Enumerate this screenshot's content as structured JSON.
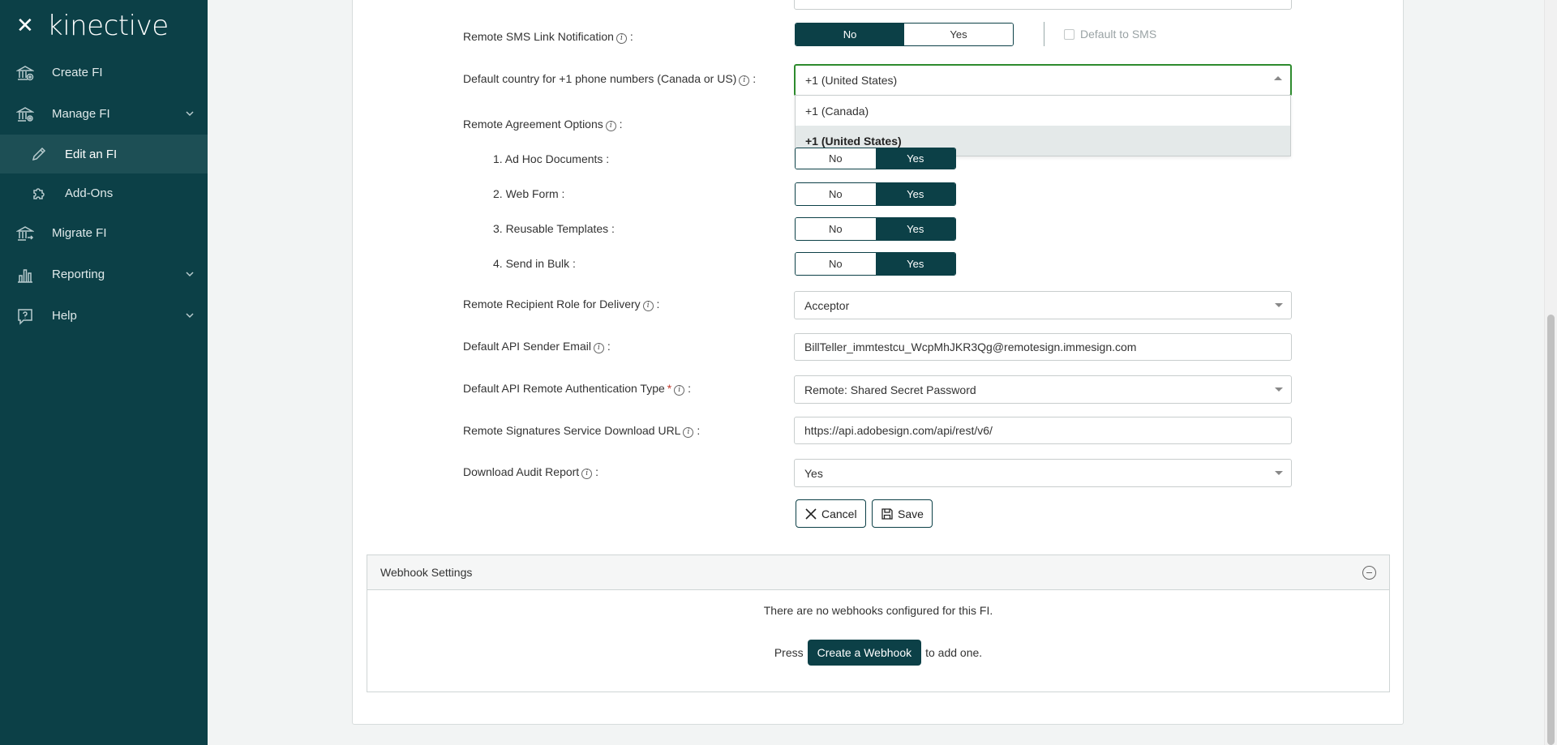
{
  "sidebar": {
    "logo": "kinective",
    "items": [
      {
        "label": "Create FI"
      },
      {
        "label": "Manage FI"
      },
      {
        "label": "Edit an FI"
      },
      {
        "label": "Add-Ons"
      },
      {
        "label": "Migrate FI"
      },
      {
        "label": "Reporting"
      },
      {
        "label": "Help"
      }
    ]
  },
  "form": {
    "sms_label": "Remote SMS Link Notification",
    "sms_toggle": {
      "no": "No",
      "yes": "Yes",
      "selected": "No"
    },
    "default_to_sms": "Default to SMS",
    "country_label": "Default country for +1 phone numbers (Canada or US)",
    "country_value": "+1 (United States)",
    "country_options": [
      "+1 (Canada)",
      "+1 (United States)"
    ],
    "agreement_label": "Remote Agreement Options",
    "agreement_options": [
      {
        "label": "1. Ad Hoc Documents :",
        "no": "No",
        "yes": "Yes",
        "selected": "Yes"
      },
      {
        "label": "2. Web Form :",
        "no": "No",
        "yes": "Yes",
        "selected": "Yes"
      },
      {
        "label": "3. Reusable Templates :",
        "no": "No",
        "yes": "Yes",
        "selected": "Yes"
      },
      {
        "label": "4. Send in Bulk :",
        "no": "No",
        "yes": "Yes",
        "selected": "Yes"
      }
    ],
    "recipient_role_label": "Remote Recipient Role for Delivery",
    "recipient_role_value": "Acceptor",
    "sender_email_label": "Default API Sender Email",
    "sender_email_value": "BillTeller_immtestcu_WcpMhJKR3Qg@remotesign.immesign.com",
    "auth_type_label": "Default API Remote Authentication Type",
    "auth_type_value": "Remote: Shared Secret Password",
    "download_url_label": "Remote Signatures Service Download URL",
    "download_url_value": "https://api.adobesign.com/api/rest/v6/",
    "audit_label": "Download Audit Report",
    "audit_value": "Yes",
    "colon": ":",
    "cancel_label": "Cancel",
    "save_label": "Save"
  },
  "webhooks": {
    "title": "Webhook Settings",
    "empty_text": "There are no webhooks configured for this FI.",
    "press": "Press",
    "create_label": "Create a Webhook",
    "to_add": "to add one."
  },
  "colors": {
    "primary": "#0c4047",
    "focus_border": "#2e8b2e",
    "required": "#c0392b"
  }
}
